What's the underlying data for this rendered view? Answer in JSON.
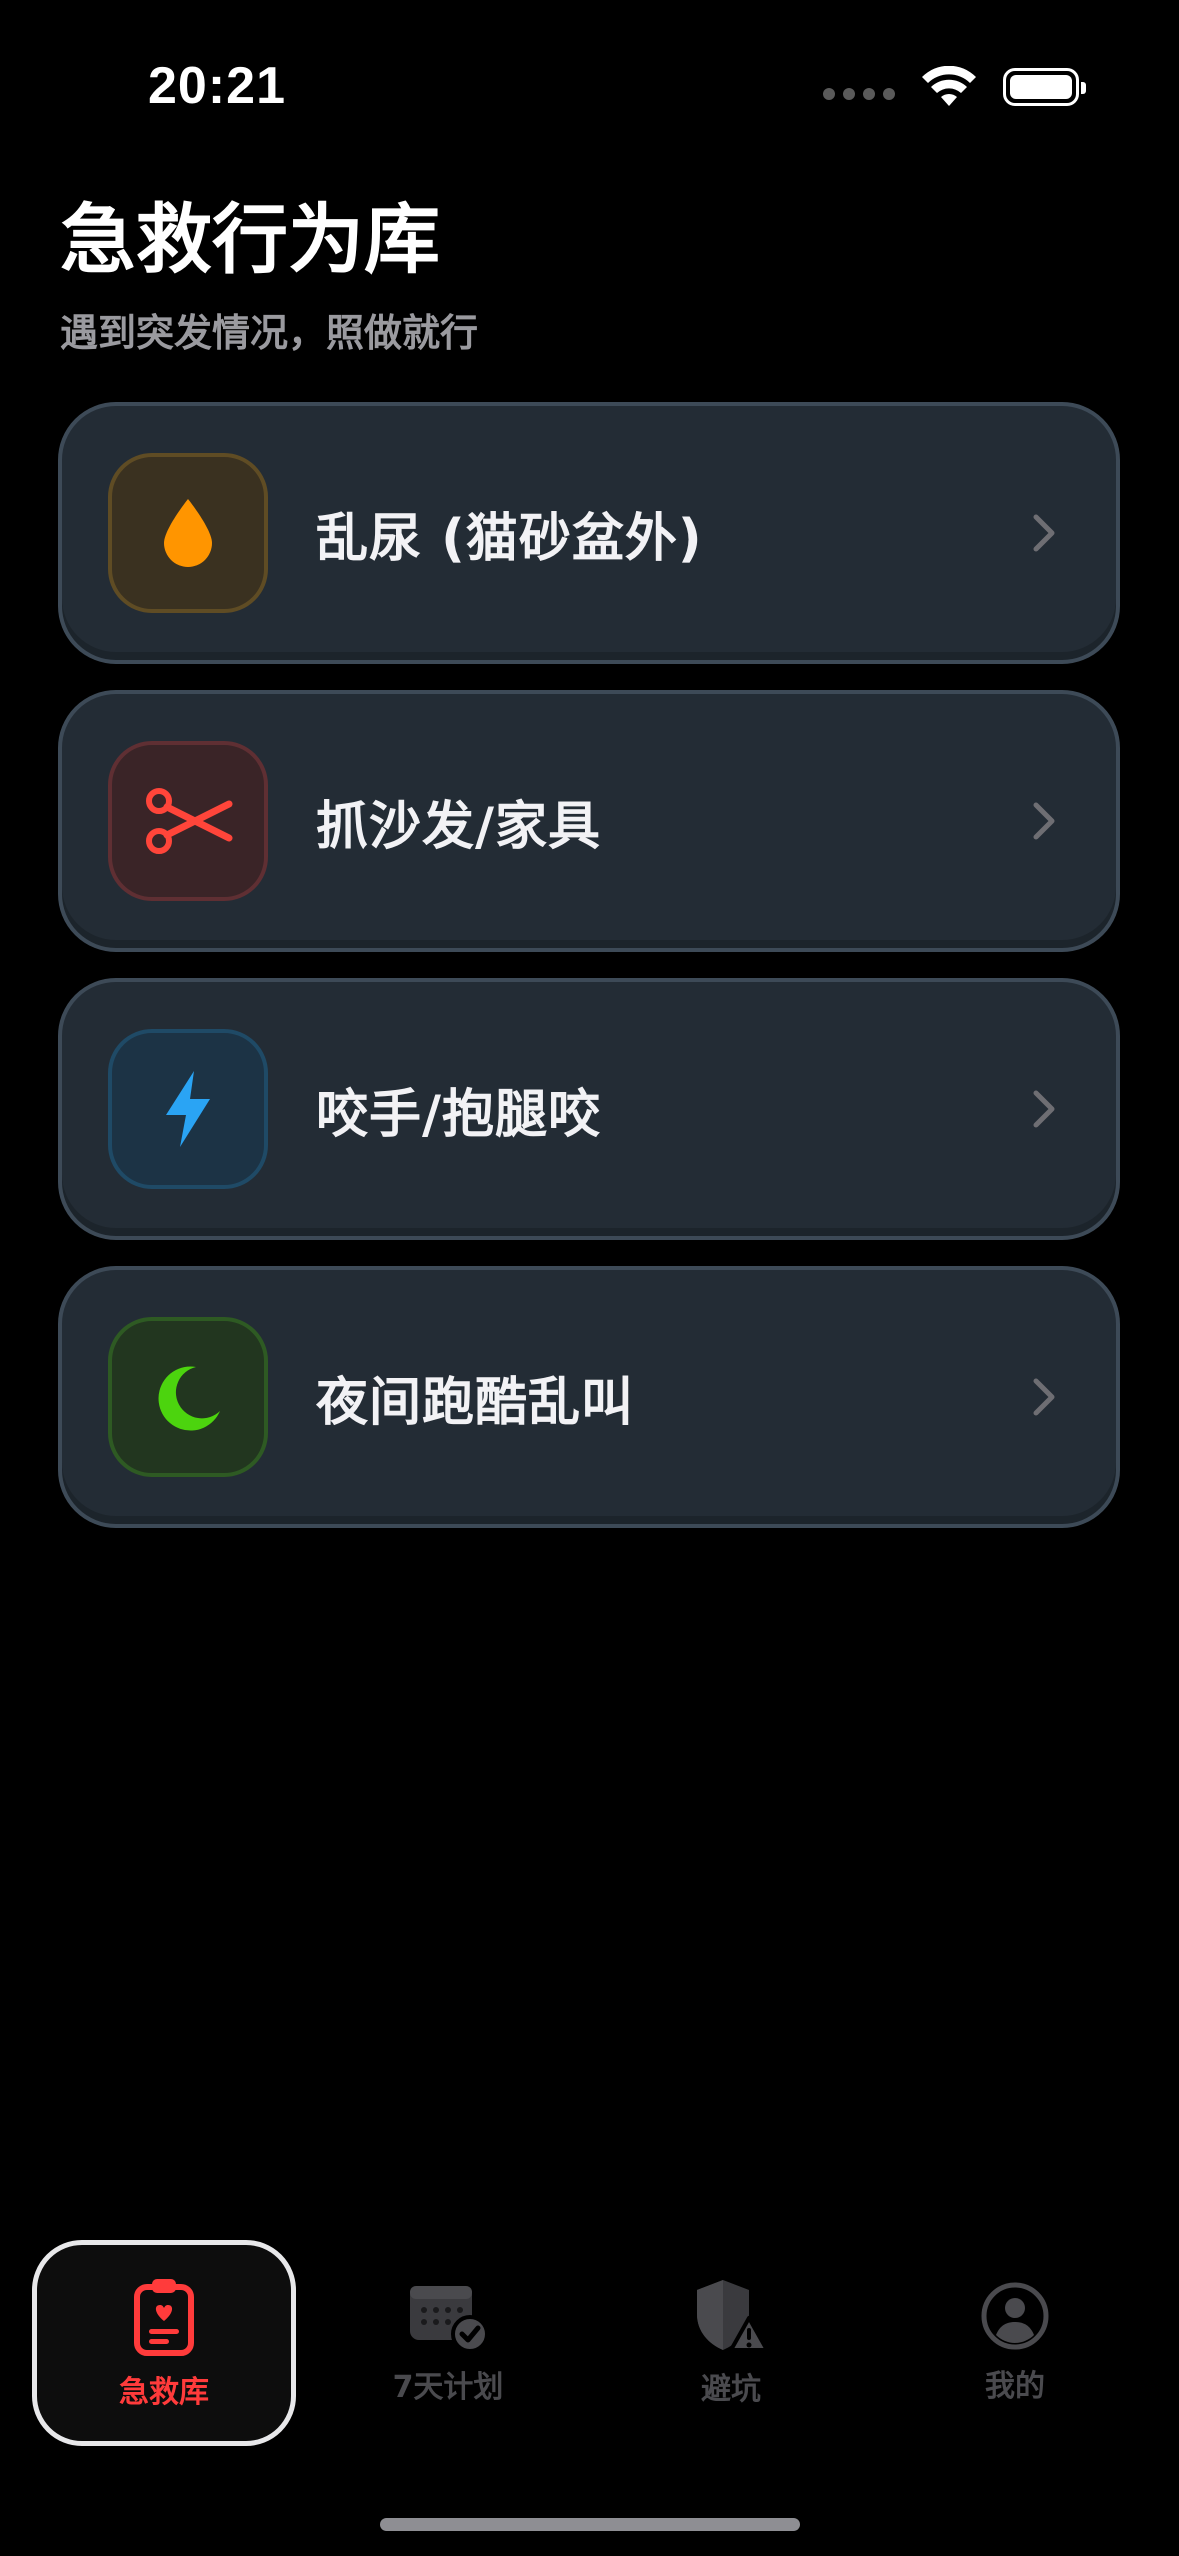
{
  "status_bar": {
    "time": "20:21"
  },
  "header": {
    "title": "急救行为库",
    "subtitle": "遇到突发情况，照做就行"
  },
  "cards": [
    {
      "label": "乱尿 (猫砂盆外)",
      "icon": "droplet-icon",
      "accent": "#ff9500"
    },
    {
      "label": "抓沙发/家具",
      "icon": "scissors-icon",
      "accent": "#ff453a"
    },
    {
      "label": "咬手/抱腿咬",
      "icon": "bolt-icon",
      "accent": "#2aa4f4"
    },
    {
      "label": "夜间跑酷乱叫",
      "icon": "moon-icon",
      "accent": "#4cd40e"
    }
  ],
  "tabs": [
    {
      "label": "急救库",
      "icon": "clipboard-heart-icon",
      "active": true
    },
    {
      "label": "7天计划",
      "icon": "calendar-check-icon",
      "active": false
    },
    {
      "label": "避坑",
      "icon": "shield-warning-icon",
      "active": false
    },
    {
      "label": "我的",
      "icon": "person-circle-icon",
      "active": false
    }
  ],
  "colors": {
    "background": "#000000",
    "card_background": "#232c35",
    "card_border": "#3d4a57",
    "active_tab_accent": "#ff3b3b",
    "inactive_tab": "#4a4a4e"
  }
}
